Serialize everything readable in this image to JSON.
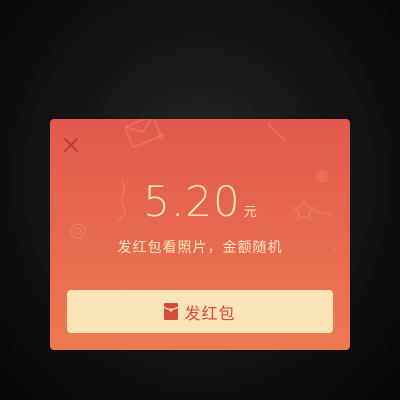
{
  "modal": {
    "amount": "5.20",
    "unit": "元",
    "subtitle": "发红包看照片，金额随机",
    "send_button_label": "发红包",
    "close_icon": "close-icon",
    "envelope_icon": "red-envelope-icon"
  },
  "colors": {
    "modal_top": "#e05a4d",
    "modal_bottom": "#ec7a52",
    "gold_text": "#f9e3b3",
    "button_bg": "#fbe3b8",
    "button_text": "#d84a3c"
  }
}
